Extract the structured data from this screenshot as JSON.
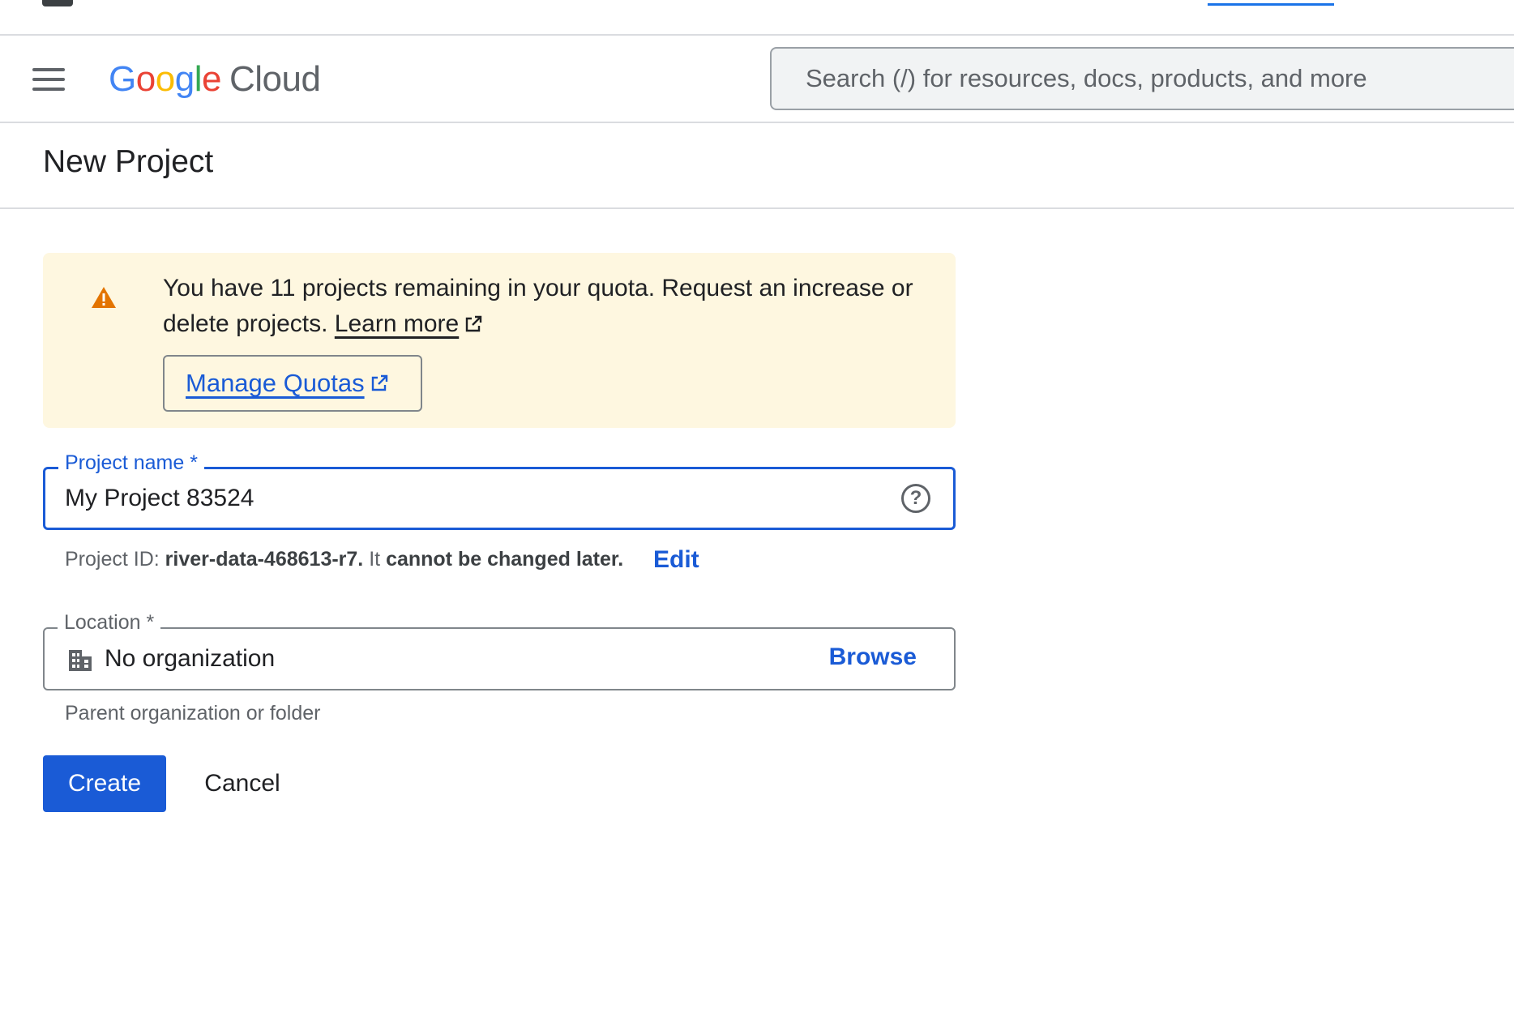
{
  "header": {
    "logo_letters": [
      "G",
      "o",
      "o",
      "g",
      "l",
      "e"
    ],
    "logo_product": "Cloud",
    "search_placeholder": "Search (/) for resources, docs, products, and more"
  },
  "page": {
    "title": "New Project"
  },
  "quota_warning": {
    "text": "You have 11 projects remaining in your quota. Request an increase or delete projects.",
    "learn_more_label": "Learn more",
    "manage_quotas_label": "Manage Quotas",
    "icon": "warning-triangle-icon",
    "background_color": "#fef7e0",
    "icon_color": "#e37400"
  },
  "project_name": {
    "label": "Project name *",
    "value": "My Project 83524"
  },
  "project_id": {
    "prefix": "Project ID:",
    "id": "river-data-468613-r7.",
    "middle": "It",
    "suffix": "cannot be changed later.",
    "edit_label": "Edit"
  },
  "location": {
    "label": "Location *",
    "value": "No organization",
    "browse_label": "Browse",
    "hint": "Parent organization or folder",
    "icon": "building-icon"
  },
  "actions": {
    "create_label": "Create",
    "cancel_label": "Cancel"
  },
  "colors": {
    "accent": "#1a5bd6",
    "text": "#202124",
    "muted": "#5f6368",
    "border": "#dadce0"
  }
}
